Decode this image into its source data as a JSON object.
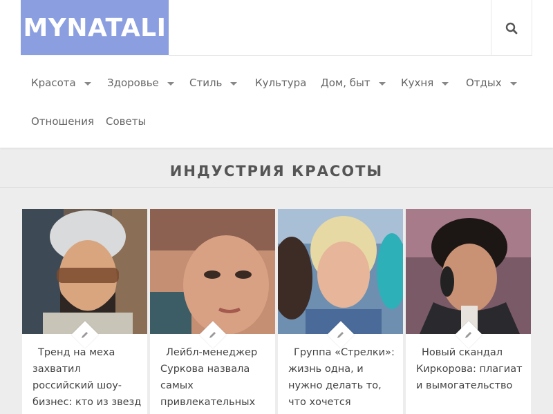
{
  "site": {
    "logo_text": "MYNATALI",
    "logo_color": "#8b9ee0",
    "search_icon": "search-icon"
  },
  "nav": {
    "items": [
      {
        "label": "Красота",
        "dropdown": true
      },
      {
        "label": "Здоровье",
        "dropdown": true
      },
      {
        "label": "Стиль",
        "dropdown": true
      },
      {
        "label": "Культура",
        "dropdown": false
      },
      {
        "label": "Дом, быт",
        "dropdown": true
      },
      {
        "label": "Кухня",
        "dropdown": true
      },
      {
        "label": "Отдых",
        "dropdown": true
      },
      {
        "label": "Отношения",
        "dropdown": false
      },
      {
        "label": "Советы",
        "dropdown": false
      }
    ]
  },
  "section": {
    "title": "ИНДУСТРИЯ КРАСОТЫ"
  },
  "cards": [
    {
      "title": "Тренд на меха захватил российский шоу-бизнес: кто из звезд поддерживает",
      "icon": "pencil-icon"
    },
    {
      "title": "Лейбл-менеджер Суркова назвала самых привлекательных",
      "icon": "pencil-icon"
    },
    {
      "title": "Группа «Стрелки»: жизнь одна, и нужно делать то, что хочется",
      "icon": "pencil-icon"
    },
    {
      "title": "Новый скандал Киркорова: плагиат и вымогательство",
      "icon": "pencil-icon"
    }
  ]
}
